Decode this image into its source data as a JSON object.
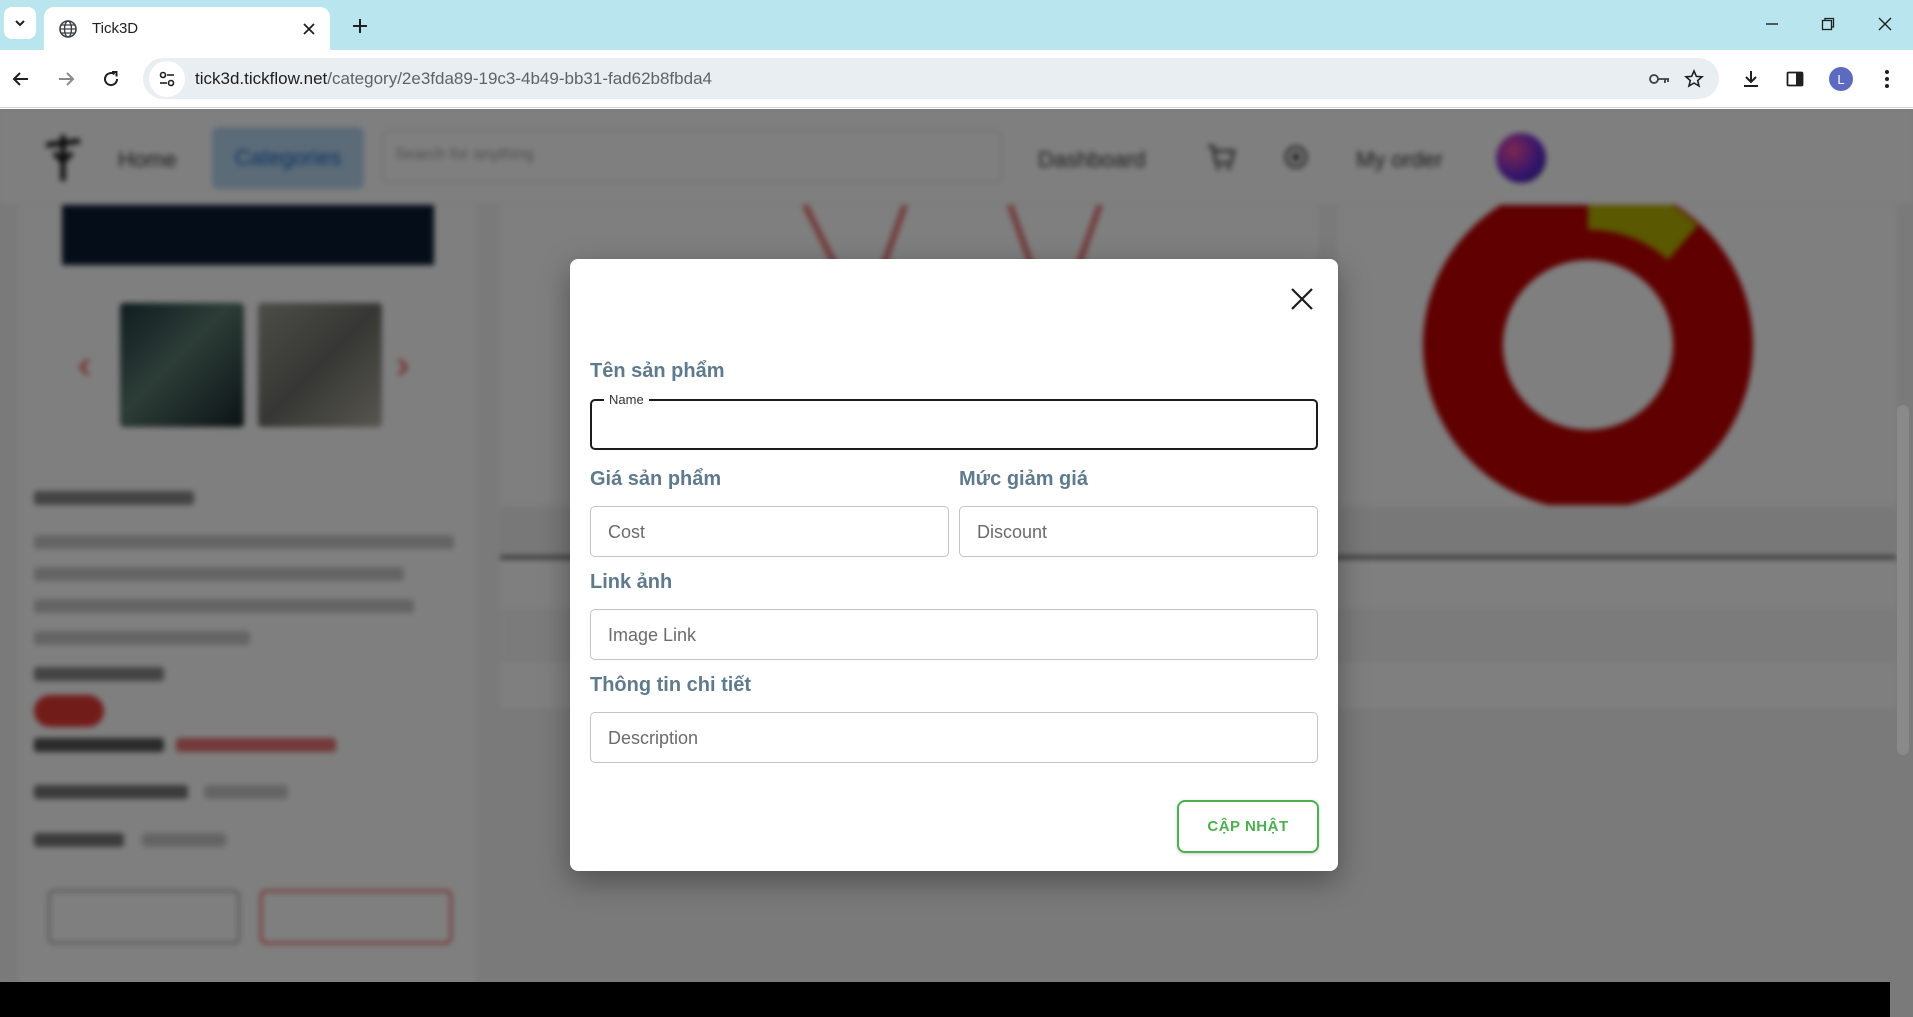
{
  "browser": {
    "tab_title": "Tick3D",
    "url_host": "tick3d.tickflow.net",
    "url_path": "/category/2e3fda89-19c3-4b49-bb31-fad62b8fbda4",
    "profile_initial": "L"
  },
  "site_nav": {
    "home": "Home",
    "categories": "Categories",
    "search_placeholder": "Search for anything",
    "dashboard": "Dashboard",
    "my_order": "My order"
  },
  "modal": {
    "name_section_label": "Tên sản phẩm",
    "name_field_label": "Name",
    "name_value": "",
    "price_section_label": "Giá sản phẩm",
    "cost_placeholder": "Cost",
    "discount_section_label": "Mức giảm giá",
    "discount_placeholder": "Discount",
    "image_section_label": "Link ảnh",
    "image_placeholder": "Image Link",
    "detail_section_label": "Thông tin chi tiết",
    "description_placeholder": "Description",
    "update_button": "CẬP NHẬT"
  },
  "colors": {
    "label": "#5f7a8c",
    "accent_green": "#4caf50",
    "tab_strip": "#b9e5ef"
  }
}
